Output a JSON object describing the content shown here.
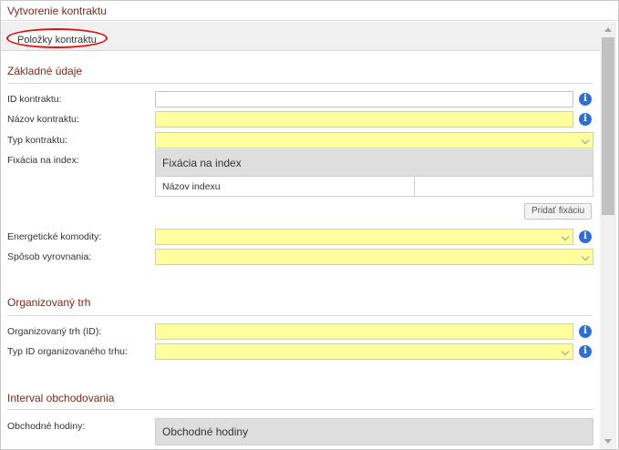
{
  "window": {
    "title": "Vytvorenie kontraktu"
  },
  "tabs": [
    {
      "label": "Položky kontraktu"
    }
  ],
  "sections": {
    "basic": {
      "title": "Základné údaje",
      "fields": {
        "contract_id": {
          "label": "ID kontraktu:",
          "value": ""
        },
        "contract_name": {
          "label": "Názov kontraktu:",
          "value": ""
        },
        "contract_type": {
          "label": "Typ kontraktu:",
          "value": ""
        },
        "index_fixing": {
          "label": "Fixácia na index:",
          "grid_title": "Fixácia na index",
          "column_header": "Názov indexu",
          "add_button": "Pridať fixáciu"
        },
        "energy_commodities": {
          "label": "Energetické komodity:",
          "value": ""
        },
        "settlement_method": {
          "label": "Spôsob vyrovnania:",
          "value": ""
        }
      }
    },
    "organized_market": {
      "title": "Organizovaný trh",
      "fields": {
        "market_id": {
          "label": "Organizovaný trh (ID):",
          "value": ""
        },
        "market_id_type": {
          "label": "Typ ID organizovaného trhu:",
          "value": ""
        }
      }
    },
    "trading_interval": {
      "title": "Interval obchodovania",
      "fields": {
        "trading_hours": {
          "label": "Obchodné hodiny:",
          "grid_title": "Obchodné hodiny"
        }
      }
    }
  },
  "icons": {
    "info": "i"
  },
  "colors": {
    "required_field": "#ffff9e",
    "section_title": "#7a2a1c",
    "info_icon": "#2e6fd6",
    "tab_highlight": "#e01010"
  }
}
